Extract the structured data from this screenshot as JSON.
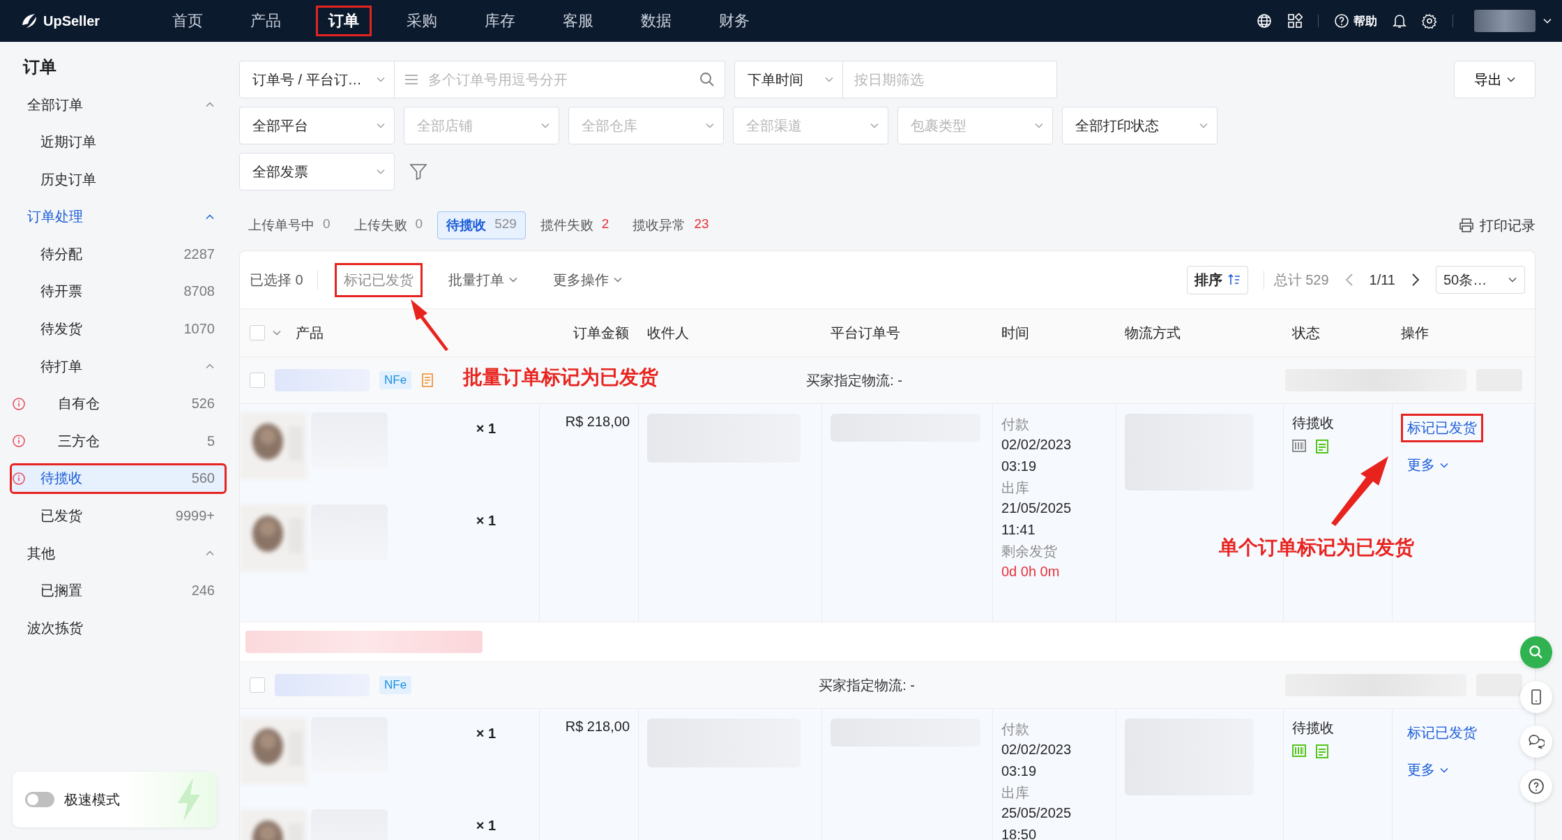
{
  "topbar": {
    "brand": "UpSeller",
    "nav": [
      {
        "label": "首页",
        "selected": false,
        "annotated": false
      },
      {
        "label": "产品",
        "selected": false,
        "annotated": false
      },
      {
        "label": "订单",
        "selected": true,
        "annotated": true
      },
      {
        "label": "采购",
        "selected": false,
        "annotated": false
      },
      {
        "label": "库存",
        "selected": false,
        "annotated": false
      },
      {
        "label": "客服",
        "selected": false,
        "annotated": false
      },
      {
        "label": "数据",
        "selected": false,
        "annotated": false
      },
      {
        "label": "财务",
        "selected": false,
        "annotated": false
      }
    ],
    "help": "帮助"
  },
  "sidebar": {
    "title": "订单",
    "items": [
      {
        "label": "全部订单",
        "expanded": true,
        "children": [
          {
            "label": "近期订单",
            "selected": false
          },
          {
            "label": "历史订单",
            "selected": false
          }
        ]
      },
      {
        "label": "订单处理",
        "expanded": true,
        "children": [
          {
            "label": "待分配",
            "count": "2287",
            "selected": false
          },
          {
            "label": "待开票",
            "count": "8708",
            "selected": false
          },
          {
            "label": "待发货",
            "count": "1070",
            "selected": false
          },
          {
            "label": "待打单",
            "expanded": true,
            "children": [
              {
                "label": "自有仓",
                "count": "526",
                "warning": true,
                "selected": false
              },
              {
                "label": "三方仓",
                "count": "5",
                "warning": true,
                "selected": false
              }
            ]
          },
          {
            "label": "待揽收",
            "count": "560",
            "warning": true,
            "selected": true,
            "annotated": true
          },
          {
            "label": "已发货",
            "count": "9999+",
            "selected": false
          }
        ]
      },
      {
        "label": "其他",
        "expanded": true,
        "children": [
          {
            "label": "已搁置",
            "count": "246",
            "selected": false
          }
        ]
      },
      {
        "label": "波次拣货"
      }
    ],
    "speed_mode": {
      "label": "极速模式",
      "on": false
    }
  },
  "filters": {
    "search_type": "订单号 / 平台订…",
    "search": {
      "placeholder": "多个订单号用逗号分开"
    },
    "date_type": "下单时间",
    "date": {
      "placeholder": "按日期筛选"
    },
    "export": "导出",
    "select_rows": [
      [
        {
          "value": "全部平台"
        },
        {
          "placeholder": "全部店铺"
        },
        {
          "placeholder": "全部仓库"
        },
        {
          "placeholder": "全部渠道"
        },
        {
          "placeholder": "包裹类型"
        },
        {
          "value": "全部打印状态"
        }
      ],
      [
        {
          "value": "全部发票"
        }
      ]
    ]
  },
  "status_tabs": [
    {
      "label": "上传单号中",
      "count": "0",
      "selected": false,
      "alert": false
    },
    {
      "label": "上传失败",
      "count": "0",
      "selected": false,
      "alert": false
    },
    {
      "label": "待揽收",
      "count": "529",
      "selected": true,
      "alert": false
    },
    {
      "label": "揽件失败",
      "count": "2",
      "selected": false,
      "alert": true
    },
    {
      "label": "揽收异常",
      "count": "23",
      "selected": false,
      "alert": true
    }
  ],
  "print_log": "打印记录",
  "toolbar": {
    "selected_label": "已选择",
    "selected_count": "0",
    "actions": [
      {
        "label": "标记已发货",
        "kind": "button",
        "annotated": true
      },
      {
        "label": "批量打单",
        "kind": "dropdown",
        "annotated": false
      },
      {
        "label": "更多操作",
        "kind": "dropdown",
        "annotated": false
      }
    ],
    "sort": "排序",
    "total": "总计 529",
    "page": "1/11",
    "page_size": "50条…"
  },
  "table": {
    "all_checked": false,
    "columns": [
      "产品",
      "订单金额",
      "收件人",
      "平台订单号",
      "时间",
      "物流方式",
      "状态",
      "操作"
    ],
    "orders": [
      {
        "checked": false,
        "nfe": "NFe",
        "note": true,
        "logistics": "买家指定物流: -",
        "items": [
          {
            "qty": "× 1"
          },
          {
            "qty": "× 1"
          }
        ],
        "amount": "R$ 218,00",
        "times": [
          {
            "label": "付款",
            "lines": [
              "02/02/2023",
              "03:19"
            ],
            "urgent": false
          },
          {
            "label": "出库",
            "lines": [
              "21/05/2025",
              "11:41"
            ],
            "urgent": false
          },
          {
            "label": "剩余发货",
            "lines": [
              "0d 0h 0m"
            ],
            "urgent": true
          }
        ],
        "status": "待揽收",
        "status_icons": [
          {
            "kind": "barcode",
            "color": "#8c8c8c"
          },
          {
            "kind": "document",
            "color": "#52c41a"
          }
        ],
        "actions": [
          {
            "label": "标记已发货",
            "kind": "link",
            "annotated": true
          },
          {
            "label": "更多",
            "kind": "dropdown",
            "annotated": false
          }
        ]
      },
      {
        "checked": false,
        "nfe": "NFe",
        "note": false,
        "logistics": "买家指定物流: -",
        "items": [
          {
            "qty": "× 1"
          },
          {
            "qty": "× 1"
          }
        ],
        "amount": "R$ 218,00",
        "times": [
          {
            "label": "付款",
            "lines": [
              "02/02/2023",
              "03:19"
            ],
            "urgent": false
          },
          {
            "label": "出库",
            "lines": [
              "25/05/2025",
              "18:50"
            ],
            "urgent": false
          }
        ],
        "status": "待揽收",
        "status_icons": [
          {
            "kind": "barcode",
            "color": "#52c41a"
          },
          {
            "kind": "document",
            "color": "#52c41a"
          }
        ],
        "actions": [
          {
            "label": "标记已发货",
            "kind": "link",
            "annotated": false
          },
          {
            "label": "更多",
            "kind": "dropdown",
            "annotated": false
          }
        ]
      }
    ]
  },
  "annotations": [
    {
      "text": "批量订单标记为已发货"
    },
    {
      "text": "单个订单标记为已发货"
    }
  ]
}
